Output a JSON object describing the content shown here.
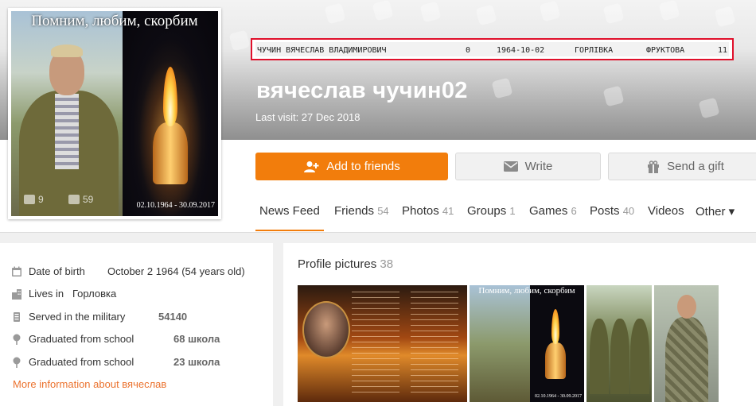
{
  "avatar": {
    "caption": "Помним, любим, скорбим",
    "dates": "02.10.1964 - 30.09.2017",
    "comments_count": "9",
    "likes_count": "59"
  },
  "record": {
    "name": "ЧУЧИН ВЯЧЕСЛАВ ВЛАДИМИРОВИЧ",
    "flag": "0",
    "birth_date": "1964-10-02",
    "city": "ГОРЛІВКА",
    "street": "ФРУКТОВА",
    "house": "11"
  },
  "profile": {
    "name": "вячеслав чучин02",
    "last_visit": "Last visit: 27 Dec 2018"
  },
  "actions": {
    "add_friends": "Add to friends",
    "write": "Write",
    "send_gift": "Send a gift"
  },
  "tabs": [
    {
      "label": "News Feed",
      "count": ""
    },
    {
      "label": "Friends",
      "count": "54"
    },
    {
      "label": "Photos",
      "count": "41"
    },
    {
      "label": "Groups",
      "count": "1"
    },
    {
      "label": "Games",
      "count": "6"
    },
    {
      "label": "Posts",
      "count": "40"
    },
    {
      "label": "Videos",
      "count": ""
    },
    {
      "label": "Other ▾",
      "count": ""
    }
  ],
  "about": {
    "rows": [
      {
        "label": "Date of birth",
        "value": "October 2 1964 (54 years old)"
      },
      {
        "label": "Lives in",
        "value": "Горловка"
      },
      {
        "label": "Served in the military",
        "value": "54140"
      },
      {
        "label": "Graduated from school",
        "value": "68 школа"
      },
      {
        "label": "Graduated from school",
        "value": "23 школа"
      }
    ],
    "more_link": "More information about вячеслав"
  },
  "profile_pictures": {
    "title": "Profile pictures",
    "count": "38",
    "thumb2_caption": "Помним, любим, скорбим",
    "thumb2_dates": "02.10.1964 - 30.09.2017"
  },
  "colors": {
    "accent": "#f27d0c",
    "highlight_border": "#e0102b",
    "link": "#eb722e"
  }
}
